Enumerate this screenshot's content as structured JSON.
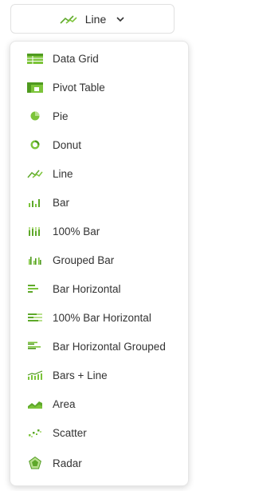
{
  "colors": {
    "accent": "#7cc43a",
    "accent_dark": "#4f9a1f",
    "accent_light": "#b9e08e"
  },
  "trigger": {
    "label": "Line",
    "icon": "line-chart-icon"
  },
  "menu": {
    "items": [
      {
        "label": "Data Grid",
        "icon": "data-grid-icon"
      },
      {
        "label": "Pivot Table",
        "icon": "pivot-table-icon"
      },
      {
        "label": "Pie",
        "icon": "pie-chart-icon"
      },
      {
        "label": "Donut",
        "icon": "donut-chart-icon"
      },
      {
        "label": "Line",
        "icon": "line-chart-icon"
      },
      {
        "label": "Bar",
        "icon": "bar-chart-icon"
      },
      {
        "label": "100% Bar",
        "icon": "full-bar-chart-icon"
      },
      {
        "label": "Grouped Bar",
        "icon": "grouped-bar-chart-icon"
      },
      {
        "label": "Bar Horizontal",
        "icon": "horizontal-bar-chart-icon"
      },
      {
        "label": "100% Bar Horizontal",
        "icon": "full-horizontal-bar-chart-icon"
      },
      {
        "label": "Bar Horizontal Grouped",
        "icon": "grouped-horizontal-bar-chart-icon"
      },
      {
        "label": "Bars + Line",
        "icon": "bars-line-chart-icon"
      },
      {
        "label": "Area",
        "icon": "area-chart-icon"
      },
      {
        "label": "Scatter",
        "icon": "scatter-chart-icon"
      },
      {
        "label": "Radar",
        "icon": "radar-chart-icon"
      }
    ]
  }
}
